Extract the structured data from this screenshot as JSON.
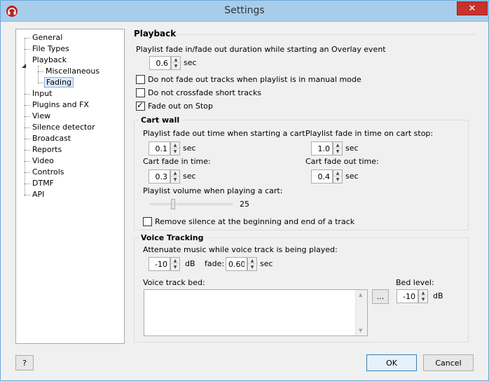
{
  "window": {
    "title": "Settings"
  },
  "tree": {
    "items": [
      {
        "label": "General"
      },
      {
        "label": "File Types"
      },
      {
        "label": "Playback"
      },
      {
        "label": "Miscellaneous"
      },
      {
        "label": "Fading"
      },
      {
        "label": "Input"
      },
      {
        "label": "Plugins and FX"
      },
      {
        "label": "View"
      },
      {
        "label": "Silence detector"
      },
      {
        "label": "Broadcast"
      },
      {
        "label": "Reports"
      },
      {
        "label": "Video"
      },
      {
        "label": "Controls"
      },
      {
        "label": "DTMF"
      },
      {
        "label": "API"
      }
    ],
    "selected": "Fading"
  },
  "playback": {
    "title": "Playback",
    "overlay_label": "Playlist fade in/fade out duration while starting an Overlay event",
    "overlay_value": "0.6",
    "sec": "sec",
    "no_fade_manual": "Do not fade out tracks when playlist is in manual mode",
    "no_crossfade_short": "Do not crossfade short tracks",
    "fade_out_on_stop": "Fade out on Stop",
    "fade_out_on_stop_checked": true
  },
  "cart_wall": {
    "title": "Cart wall",
    "fade_out_label": "Playlist fade out time when starting a cart:",
    "fade_out_value": "0.1",
    "fade_in_stop_label": "Playlist fade in time on cart stop:",
    "fade_in_stop_value": "1.0",
    "cart_fade_in_label": "Cart fade in time:",
    "cart_fade_in_value": "0.3",
    "cart_fade_out_label": "Cart fade out time:",
    "cart_fade_out_value": "0.4",
    "volume_label": "Playlist volume when playing a cart:",
    "volume_value": "25",
    "remove_silence": "Remove silence at the beginning and end of a track"
  },
  "voice_tracking": {
    "title": "Voice Tracking",
    "attenuate_label": "Attenuate music while voice track is being played:",
    "attenuate_value": "-10",
    "db": "dB",
    "fade_label": "fade:",
    "fade_value": "0.60",
    "bed_label": "Voice track bed:",
    "browse": "...",
    "bed_level_label": "Bed level:",
    "bed_level_value": "-10"
  },
  "buttons": {
    "help": "?",
    "ok": "OK",
    "cancel": "Cancel"
  }
}
